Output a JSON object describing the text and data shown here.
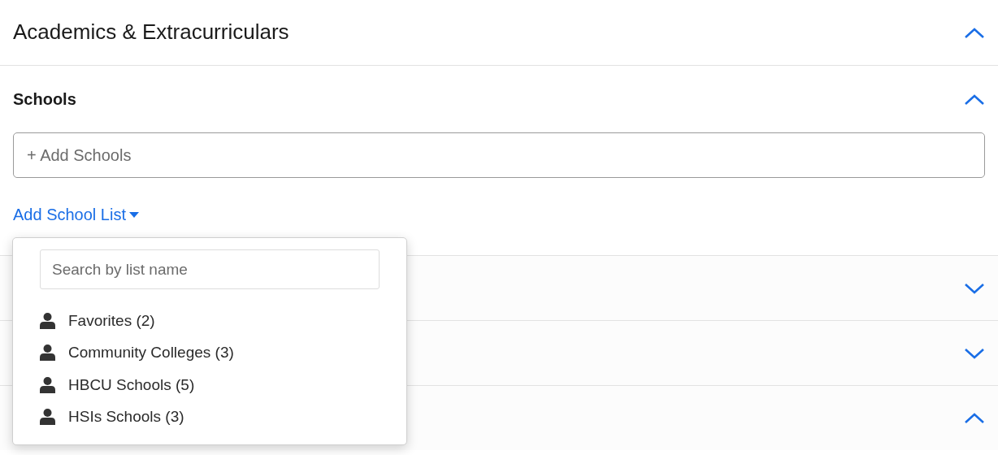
{
  "header": {
    "title": "Academics & Extracurriculars",
    "expanded": true
  },
  "schools": {
    "title": "Schools",
    "expanded": true,
    "field": {
      "placeholder": "+ Add Schools"
    },
    "list_link": "Add School List"
  },
  "school_list_menu": {
    "search": {
      "placeholder": "Search by list name"
    },
    "items": [
      {
        "label": "Favorites (2)"
      },
      {
        "label": "Community Colleges (3)"
      },
      {
        "label": "HBCU Schools (5)"
      },
      {
        "label": "HSIs Schools (3)"
      }
    ]
  },
  "other_sections": [
    {
      "expanded": false
    },
    {
      "expanded": false
    },
    {
      "expanded": true
    }
  ]
}
